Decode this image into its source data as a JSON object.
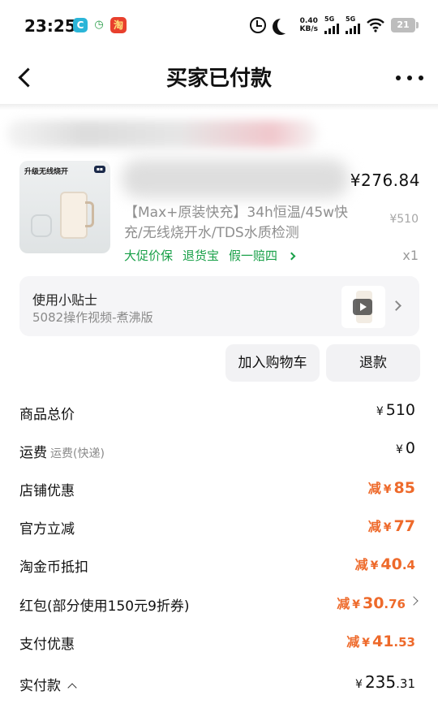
{
  "status_bar": {
    "time": "23:25",
    "app_icons": [
      "c-app-icon",
      "clock-app-icon",
      "taobao-app-icon"
    ],
    "speed_value": "0.40",
    "speed_unit": "KB/s",
    "signal1_label": "5G",
    "signal2_label": "5G",
    "battery": "21"
  },
  "nav": {
    "title": "买家已付款"
  },
  "product": {
    "image_label": "升级无线烧开",
    "price": "¥276.84",
    "title": "【Max+原装快充】34h恒温/45w快充/无线烧开水/TDS水质检测",
    "original_price": "¥510",
    "quantity": "x1",
    "tags": [
      "大促价保",
      "退货宝",
      "假一赔四"
    ]
  },
  "tips": {
    "title": "使用小贴士",
    "subtitle": "5082操作视频-煮沸版"
  },
  "buttons": {
    "add_to_cart": "加入购物车",
    "refund": "退款"
  },
  "price_rows": {
    "goods_total": {
      "label": "商品总价",
      "currency": "¥",
      "value": "510"
    },
    "shipping": {
      "label": "运费",
      "sub": "运费(快递)",
      "currency": "¥",
      "value": "0"
    },
    "shop_discount": {
      "label": "店铺优惠",
      "prefix": "减",
      "currency": "¥",
      "value": "85"
    },
    "official_discount": {
      "label": "官方立减",
      "prefix": "减",
      "currency": "¥",
      "value": "77"
    },
    "coin_deduct": {
      "label": "淘金币抵扣",
      "prefix": "减",
      "currency": "¥",
      "int": "40",
      "dec": ".4"
    },
    "red_packet": {
      "label": "红包(部分使用150元9折券)",
      "prefix": "减",
      "currency": "¥",
      "int": "30",
      "dec": ".76"
    },
    "payment_discount": {
      "label": "支付优惠",
      "prefix": "减",
      "currency": "¥",
      "int": "41",
      "dec": ".53"
    },
    "actual_paid": {
      "label": "实付款",
      "currency": "¥",
      "int": "235",
      "dec": ".31"
    }
  },
  "colors": {
    "green_tag": "#18a048",
    "discount_orange": "#ee6a2b"
  }
}
